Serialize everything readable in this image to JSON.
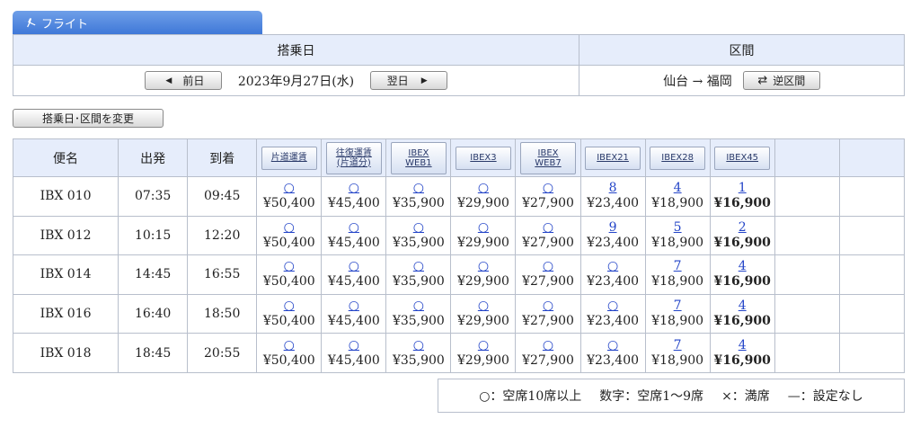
{
  "tab": {
    "label": "フライト",
    "icon": "airplane-icon"
  },
  "header": {
    "date_heading": "搭乗日",
    "route_heading": "区間",
    "prev_day_label": "前日",
    "next_day_label": "翌日",
    "date_value": "2023年9月27日(水)",
    "route_value": "仙台 → 福岡",
    "reverse_label": "逆区間"
  },
  "change_button_label": "搭乗日･区間を変更",
  "table": {
    "col_flight": "便名",
    "col_depart": "出発",
    "col_arrive": "到着",
    "fare_headers": [
      {
        "line1": "片道運賃",
        "line2": ""
      },
      {
        "line1": "往復運賃",
        "line2": "(片道分)"
      },
      {
        "line1": "IBEX",
        "line2": "WEB1"
      },
      {
        "line1": "IBEX3",
        "line2": ""
      },
      {
        "line1": "IBEX",
        "line2": "WEB7"
      },
      {
        "line1": "IBEX21",
        "line2": ""
      },
      {
        "line1": "IBEX28",
        "line2": ""
      },
      {
        "line1": "IBEX45",
        "line2": ""
      }
    ],
    "rows": [
      {
        "flight": "IBX 010",
        "depart": "07:35",
        "arrive": "09:45",
        "fares": [
          [
            "○",
            "¥50,400"
          ],
          [
            "○",
            "¥45,400"
          ],
          [
            "○",
            "¥35,900"
          ],
          [
            "○",
            "¥29,900"
          ],
          [
            "○",
            "¥27,900"
          ],
          [
            "8",
            "¥23,400"
          ],
          [
            "4",
            "¥18,900"
          ],
          [
            "1",
            "¥16,900"
          ]
        ]
      },
      {
        "flight": "IBX 012",
        "depart": "10:15",
        "arrive": "12:20",
        "fares": [
          [
            "○",
            "¥50,400"
          ],
          [
            "○",
            "¥45,400"
          ],
          [
            "○",
            "¥35,900"
          ],
          [
            "○",
            "¥29,900"
          ],
          [
            "○",
            "¥27,900"
          ],
          [
            "9",
            "¥23,400"
          ],
          [
            "5",
            "¥18,900"
          ],
          [
            "2",
            "¥16,900"
          ]
        ]
      },
      {
        "flight": "IBX 014",
        "depart": "14:45",
        "arrive": "16:55",
        "fares": [
          [
            "○",
            "¥50,400"
          ],
          [
            "○",
            "¥45,400"
          ],
          [
            "○",
            "¥35,900"
          ],
          [
            "○",
            "¥29,900"
          ],
          [
            "○",
            "¥27,900"
          ],
          [
            "○",
            "¥23,400"
          ],
          [
            "7",
            "¥18,900"
          ],
          [
            "4",
            "¥16,900"
          ]
        ]
      },
      {
        "flight": "IBX 016",
        "depart": "16:40",
        "arrive": "18:50",
        "fares": [
          [
            "○",
            "¥50,400"
          ],
          [
            "○",
            "¥45,400"
          ],
          [
            "○",
            "¥35,900"
          ],
          [
            "○",
            "¥29,900"
          ],
          [
            "○",
            "¥27,900"
          ],
          [
            "○",
            "¥23,400"
          ],
          [
            "7",
            "¥18,900"
          ],
          [
            "4",
            "¥16,900"
          ]
        ]
      },
      {
        "flight": "IBX 018",
        "depart": "18:45",
        "arrive": "20:55",
        "fares": [
          [
            "○",
            "¥50,400"
          ],
          [
            "○",
            "¥45,400"
          ],
          [
            "○",
            "¥35,900"
          ],
          [
            "○",
            "¥29,900"
          ],
          [
            "○",
            "¥27,900"
          ],
          [
            "○",
            "¥23,400"
          ],
          [
            "7",
            "¥18,900"
          ],
          [
            "4",
            "¥16,900"
          ]
        ]
      }
    ]
  },
  "legend": {
    "items": [
      "○：空席10席以上",
      "数字：空席1〜9席",
      "×：満席",
      "—：設定なし"
    ]
  },
  "colors": {
    "tab": "#3f78d8",
    "header_bg": "#e6edfb",
    "link": "#2445c8",
    "border": "#b8bfcc"
  }
}
